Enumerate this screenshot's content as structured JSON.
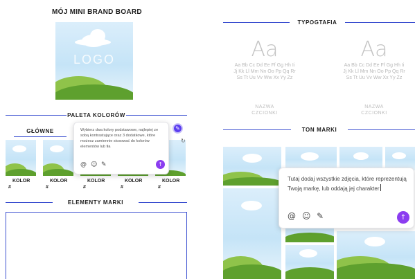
{
  "brand_board": {
    "title": "MÓJ MINI BRAND BOARD",
    "logo_text": "LOGO"
  },
  "palette": {
    "title": "PALETA KOLORÓW",
    "primary_label": "GŁÓWNE",
    "swatches": [
      {
        "label": "KOLOR",
        "hash": "#"
      },
      {
        "label": "KOLOR",
        "hash": "#"
      },
      {
        "label": "KOLOR",
        "hash": "#"
      },
      {
        "label": "KOLOR",
        "hash": "#"
      },
      {
        "label": "KOLOR",
        "hash": "#"
      }
    ],
    "popup": {
      "text": "Wybierz dwa kolory podstawowe, najlepiej ze sobą kontrastujące oraz 3 dodatkowe, które możesz zamiennie stosować do kolorów elementów lub tła",
      "icons": [
        "@",
        "☺",
        "✎"
      ],
      "send": "↑"
    },
    "edit_icon": "✎",
    "refresh_icon": "↻"
  },
  "elements": {
    "title": "ELEMENTY MARKI"
  },
  "typography": {
    "title": "TYPOGTAFIA",
    "fonts": [
      {
        "big": "Aa",
        "lines": [
          "Aa Bb Cc Dd Ee Ff Gg Hh Ii",
          "Jj Kk Ll Mm Nn Oo Pp Qq Rr",
          "Ss Tt Uu Vv Ww Xx Yy Zz"
        ],
        "name": [
          "NAZWA",
          "CZCIONKI"
        ]
      },
      {
        "big": "Aa",
        "lines": [
          "Aa Bb Cc Dd Ee Ff Gg Hh Ii",
          "Jj Kk Ll Mm Nn Oo Pp Qq Rr",
          "Ss Tt Uu Vv Ww Xx Yy Zz"
        ],
        "name": [
          "NAZWA",
          "CZCIONKI"
        ]
      }
    ]
  },
  "ton": {
    "title": "TON MARKI",
    "popup": {
      "text": "Tutaj dodaj wszystkie zdjęcia, które reprezentują Twoją markę, lub oddają jej charakter",
      "icons": [
        "@",
        "☺",
        "✎"
      ],
      "send": "↑"
    }
  },
  "colors": {
    "accent_blue": "#3b4fd0",
    "send_purple": "#8b3df0",
    "sky": "#c5e4f7",
    "grass": "#5ea02e"
  }
}
